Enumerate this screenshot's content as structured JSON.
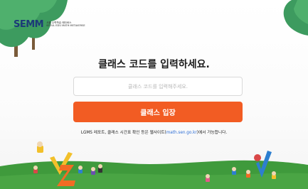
{
  "brand": {
    "logo": "SEMM",
    "line1": "서울 수학학습 메타버스",
    "line2": "SEOUL EDU MATH METAVERSE"
  },
  "title": "클래스 코드를 입력하세요.",
  "code_input": {
    "value": "",
    "placeholder": "클래스 코드를 입력해주세요."
  },
  "enter_button": {
    "label": "클래스 입장"
  },
  "notice": {
    "before": "LGMS 레포트, 클래스 시간표 확인 등은 웹사이트(",
    "link": "math.sen.go.kr",
    "after": ")에서 가능합니다."
  },
  "colors": {
    "accent": "#f25c23",
    "logo": "#1c3a78",
    "link": "#2f6fd6",
    "grass": "#3f9a3c",
    "tree": "#3d9b5f"
  }
}
